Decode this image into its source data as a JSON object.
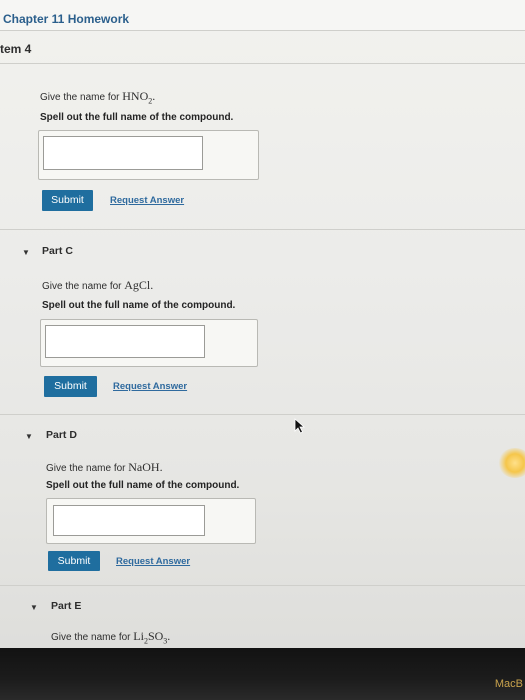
{
  "header": {
    "chapter_title": "Chapter 11 Homework",
    "item_label": "tem 4"
  },
  "part_b": {
    "prompt_prefix": "Give the name for ",
    "formula": {
      "base": "HNO",
      "subscript": "2",
      "suffix": "."
    },
    "instruction": "Spell out the full name of the compound.",
    "answer_value": "",
    "submit_label": "Submit",
    "request_label": "Request Answer"
  },
  "part_c": {
    "title": "Part C",
    "prompt_prefix": "Give the name for ",
    "formula": {
      "base": "AgCl",
      "suffix": "."
    },
    "instruction": "Spell out the full name of the compound.",
    "answer_value": "",
    "submit_label": "Submit",
    "request_label": "Request Answer"
  },
  "part_d": {
    "title": "Part D",
    "prompt_prefix": "Give the name for ",
    "formula": {
      "base": "NaOH",
      "suffix": "."
    },
    "instruction": "Spell out the full name of the compound.",
    "answer_value": "",
    "submit_label": "Submit",
    "request_label": "Request Answer"
  },
  "part_e": {
    "title": "Part E",
    "prompt_prefix": "Give the name for ",
    "formula": {
      "base1": "Li",
      "sub1": "2",
      "base2": "SO",
      "sub2": "3",
      "suffix": "."
    }
  },
  "bezel_label": "MacB",
  "colors": {
    "accent": "#1f6e9f",
    "link": "#2f6a9e",
    "title": "#2b5f8c"
  }
}
